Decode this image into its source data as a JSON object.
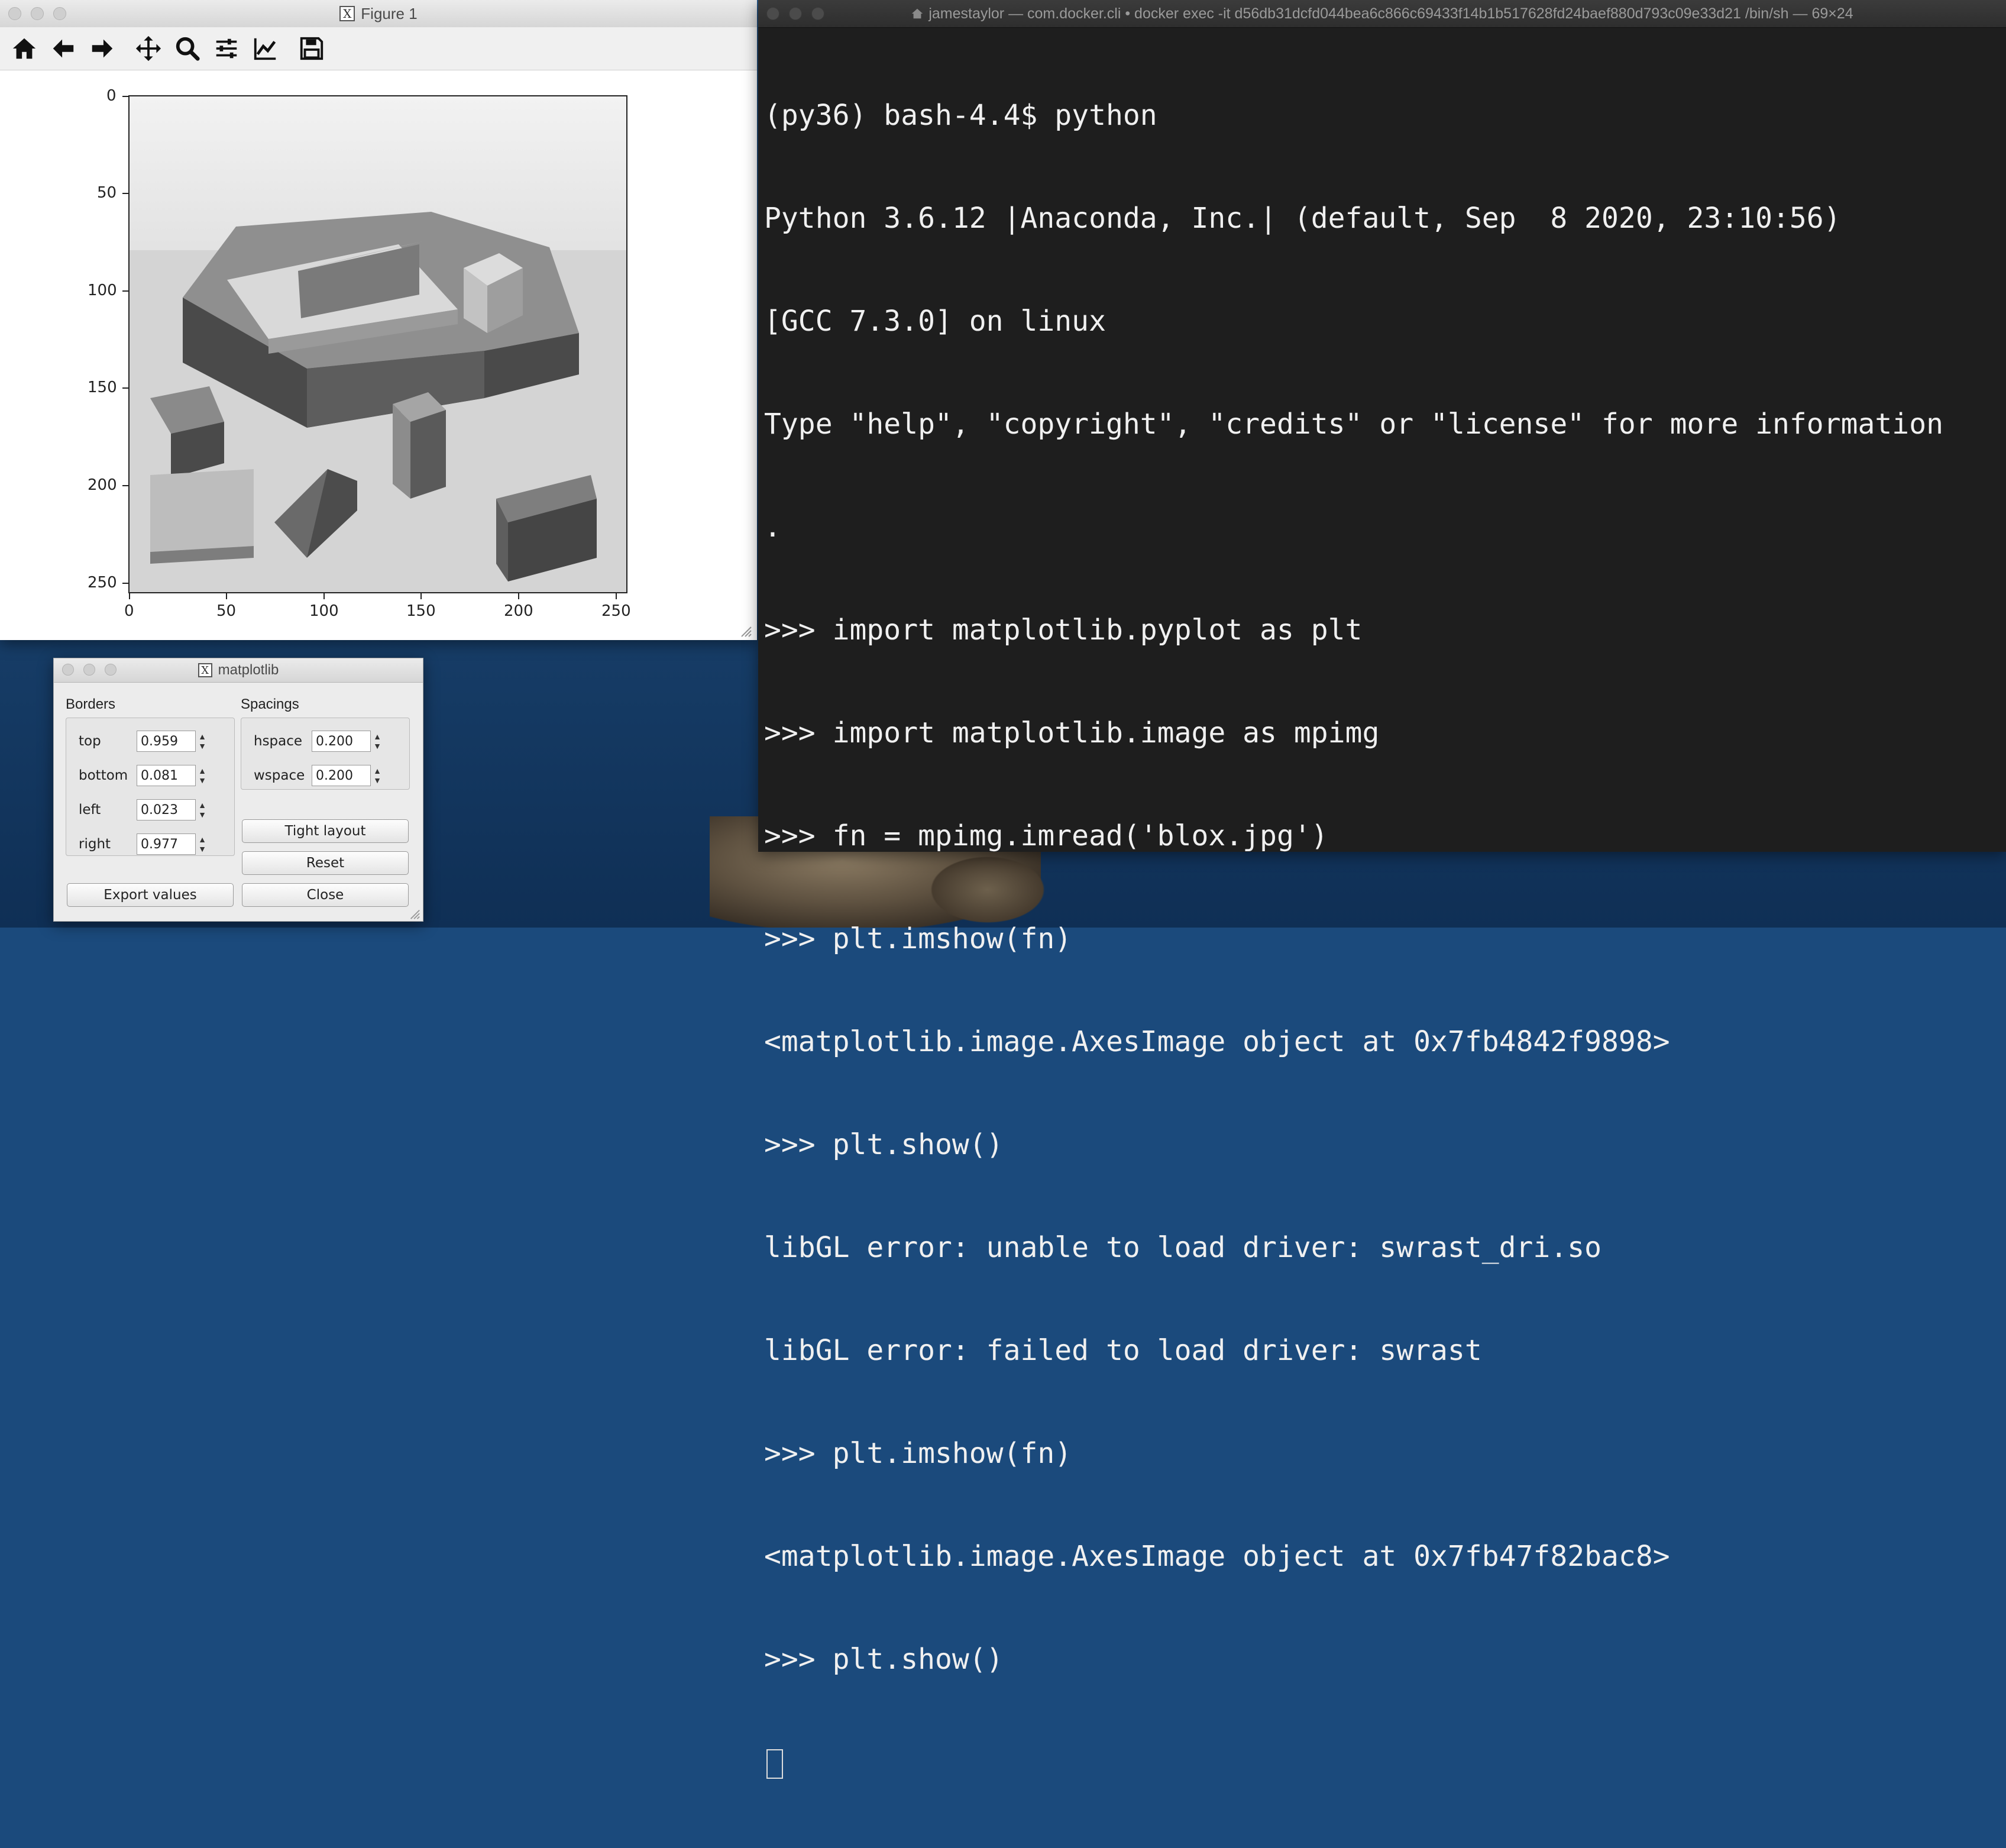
{
  "figure_window": {
    "title": "Figure 1",
    "toolbar": {
      "home_icon": "home-icon",
      "back_icon": "arrow-left-icon",
      "forward_icon": "arrow-right-icon",
      "pan_icon": "move-icon",
      "zoom_icon": "magnifier-icon",
      "subplots_icon": "sliders-icon",
      "edit_icon": "line-chart-icon",
      "save_icon": "floppy-disk-icon"
    },
    "axes": {
      "y_ticks": [
        "0",
        "50",
        "100",
        "150",
        "200",
        "250"
      ],
      "x_ticks": [
        "0",
        "50",
        "100",
        "150",
        "200",
        "250"
      ],
      "xlim": [
        0,
        256
      ],
      "ylim": [
        256,
        0
      ]
    }
  },
  "terminal": {
    "title": "jamestaylor — com.docker.cli • docker exec -it d56db31dcfd044bea6c866c69433f14b1b517628fd24baef880d793c09e33d21 /bin/sh — 69×24",
    "lines": [
      "(py36) bash-4.4$ python",
      "Python 3.6.12 |Anaconda, Inc.| (default, Sep  8 2020, 23:10:56)",
      "[GCC 7.3.0] on linux",
      "Type \"help\", \"copyright\", \"credits\" or \"license\" for more information",
      ".",
      ">>> import matplotlib.pyplot as plt",
      ">>> import matplotlib.image as mpimg",
      ">>> fn = mpimg.imread('blox.jpg')",
      ">>> plt.imshow(fn)",
      "<matplotlib.image.AxesImage object at 0x7fb4842f9898>",
      ">>> plt.show()",
      "libGL error: unable to load driver: swrast_dri.so",
      "libGL error: failed to load driver: swrast",
      ">>> plt.imshow(fn)",
      "<matplotlib.image.AxesImage object at 0x7fb47f82bac8>",
      ">>> plt.show()"
    ]
  },
  "config_dialog": {
    "title": "matplotlib",
    "borders_label": "Borders",
    "spacings_label": "Spacings",
    "borders": [
      {
        "label": "top",
        "value": "0.959"
      },
      {
        "label": "bottom",
        "value": "0.081"
      },
      {
        "label": "left",
        "value": "0.023"
      },
      {
        "label": "right",
        "value": "0.977"
      }
    ],
    "spacings": [
      {
        "label": "hspace",
        "value": "0.200"
      },
      {
        "label": "wspace",
        "value": "0.200"
      }
    ],
    "tight_layout_label": "Tight layout",
    "reset_label": "Reset",
    "close_label": "Close",
    "export_label": "Export values"
  }
}
